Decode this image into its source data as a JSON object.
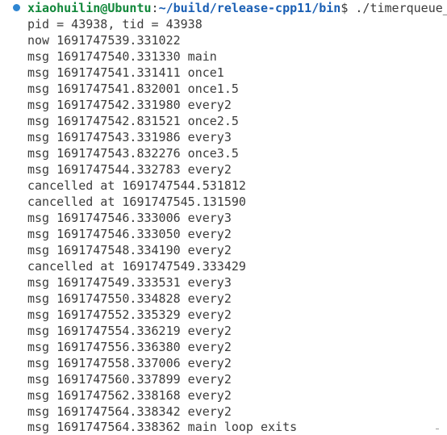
{
  "prompt": {
    "user_host": "xiaohuilin@Ubuntu",
    "separator": ":",
    "path": "~/build/release-cpp11/bin",
    "symbol": "$",
    "command": " ./timerqueue_"
  },
  "output_lines": [
    "pid = 43938, tid = 43938",
    "now 1691747539.331022",
    "msg 1691747540.331330 main",
    "msg 1691747541.331411 once1",
    "msg 1691747541.832001 once1.5",
    "msg 1691747542.331980 every2",
    "msg 1691747542.831521 once2.5",
    "msg 1691747543.331986 every3",
    "msg 1691747543.832276 once3.5",
    "msg 1691747544.332783 every2",
    "cancelled at 1691747544.531812",
    "cancelled at 1691747545.131590",
    "msg 1691747546.333006 every3",
    "msg 1691747546.333050 every2",
    "msg 1691747548.334190 every2",
    "cancelled at 1691747549.333429",
    "msg 1691747549.333531 every3",
    "msg 1691747550.334828 every2",
    "msg 1691747552.335329 every2",
    "msg 1691747554.336219 every2",
    "msg 1691747556.336380 every2",
    "msg 1691747558.337006 every2",
    "msg 1691747560.337899 every2",
    "msg 1691747562.338168 every2",
    "msg 1691747564.338342 every2",
    "msg 1691747564.338362 main loop exits"
  ],
  "colors": {
    "status_dot": "#2f86d2",
    "user_host": "#11873a",
    "path": "#1a5fb4",
    "text": "#3b3b3b"
  }
}
